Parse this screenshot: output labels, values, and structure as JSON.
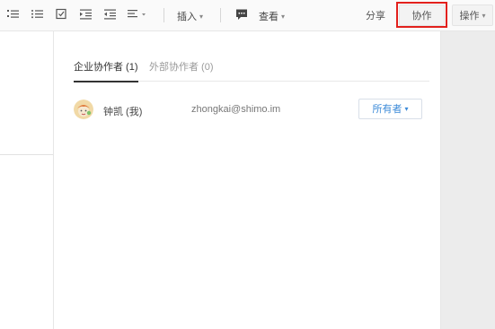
{
  "toolbar": {
    "icons": [
      "ordered-list-icon",
      "unordered-list-icon",
      "checklist-icon",
      "indent-increase-icon",
      "indent-decrease-icon",
      "align-icon"
    ],
    "insert_label": "插入",
    "comment_icon": "comment-icon",
    "view_label": "查看",
    "share_label": "分享",
    "collaborate_label": "协作",
    "actions_label": "操作"
  },
  "colors": {
    "highlight": "#e2201c",
    "role_accent": "#3b8ad8"
  },
  "collab_panel": {
    "tabs": [
      {
        "label": "企业协作者 (1)",
        "active": true
      },
      {
        "label": "外部协作者 (0)",
        "active": false
      }
    ],
    "members": [
      {
        "avatar_icon": "avatar-icon",
        "name": "钟凯 (我)",
        "email": "zhongkai@shimo.im",
        "role": "所有者"
      }
    ]
  }
}
